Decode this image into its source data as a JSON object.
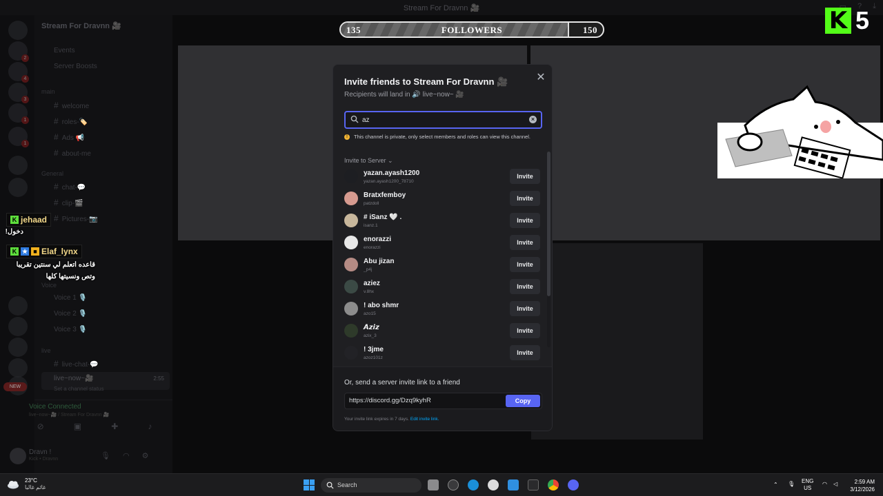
{
  "window": {
    "title": "Stream For Dravnn 🎥"
  },
  "server": {
    "name": "Stream For Dravnn 🎥",
    "top_items": [
      "Events",
      "Server Boosts"
    ],
    "categories": [
      {
        "name": "main",
        "channels": [
          "welcome",
          "roles-🏷️",
          "Ads 📢",
          "about-me"
        ]
      },
      {
        "name": "General",
        "channels": [
          "chat-💬",
          "clip-🎬",
          "Pictures-📷"
        ]
      },
      {
        "name": "Voice",
        "channels": [
          "Voice 1 🎙️",
          "Voice 2 🎙️",
          "Voice 3 🎙️"
        ]
      },
      {
        "name": "live",
        "channels": [
          "live-chat-💬",
          "live~now~🎥"
        ]
      }
    ],
    "set_status": "Set a channel status",
    "new_badge": "NEW",
    "voice_connected": "Voice Connected",
    "voice_channel_path": "live~now~🎥 / Stream For Dravnn 🎥",
    "voice_timer": "2:55",
    "user_name": "Dravn !",
    "user_status": "Kick • Dravnn"
  },
  "stream_overlay": {
    "followers": {
      "label": "FOLLOWERS",
      "current": "135",
      "goal": "150",
      "progress_fraction": 0.87
    },
    "k_logo": "K",
    "k_number": "5",
    "chat": [
      {
        "user": "jehaad",
        "message": "دخول!"
      },
      {
        "user": "Elaf_lynx",
        "message": "قاعده اتعلم لي سنتين تقريبا وتص ونسيتها كلها"
      }
    ]
  },
  "modal": {
    "title": "Invite friends to Stream For Dravnn 🎥",
    "subtitle": "Recipients will land in 🔊 live~now~ 🎥",
    "search_value": "az",
    "warning": "This channel is private, only select members and roles can view this channel.",
    "section_label": "Invite to Server",
    "invite_label": "Invite",
    "users": [
      {
        "name": "yazan.ayash1200",
        "handle": "yazan.ayash1200_78710",
        "color": "#1d1e22"
      },
      {
        "name": "Bratxfemboy",
        "handle": "patzdoll",
        "color": "#d69a8f"
      },
      {
        "name": "# iSanz 🤍 .",
        "handle": "isanz.1",
        "color": "#c8b79c"
      },
      {
        "name": "enorazzi",
        "handle": "enorazzi",
        "color": "#e8e8e8"
      },
      {
        "name": "Abu jizan",
        "handle": "_p4j",
        "color": "#b58b84"
      },
      {
        "name": "aziez",
        "handle": "v.8hx",
        "color": "#3b4a45"
      },
      {
        "name": "! abo shmr",
        "handle": "azo15",
        "color": "#8c8c8c"
      },
      {
        "name": "𝘼𝙯𝙞𝙯",
        "handle": "azix_3",
        "color": "#2e3a2a"
      },
      {
        "name": "! 3jme",
        "handle": "azoz101z",
        "color": "#222226"
      }
    ],
    "footer_label": "Or, send a server invite link to a friend",
    "invite_link": "https://discord.gg/Dzq9kyhR",
    "copy_label": "Copy",
    "expire_text": "Your invite link expires in 7 days.",
    "edit_link_label": "Edit invite link."
  },
  "taskbar": {
    "weather_temp": "23°C",
    "weather_desc": "غائم غالبا",
    "search_label": "Search",
    "lang_top": "ENG",
    "lang_bottom": "US",
    "time": "2:59 AM",
    "date": "3/12/2026"
  }
}
